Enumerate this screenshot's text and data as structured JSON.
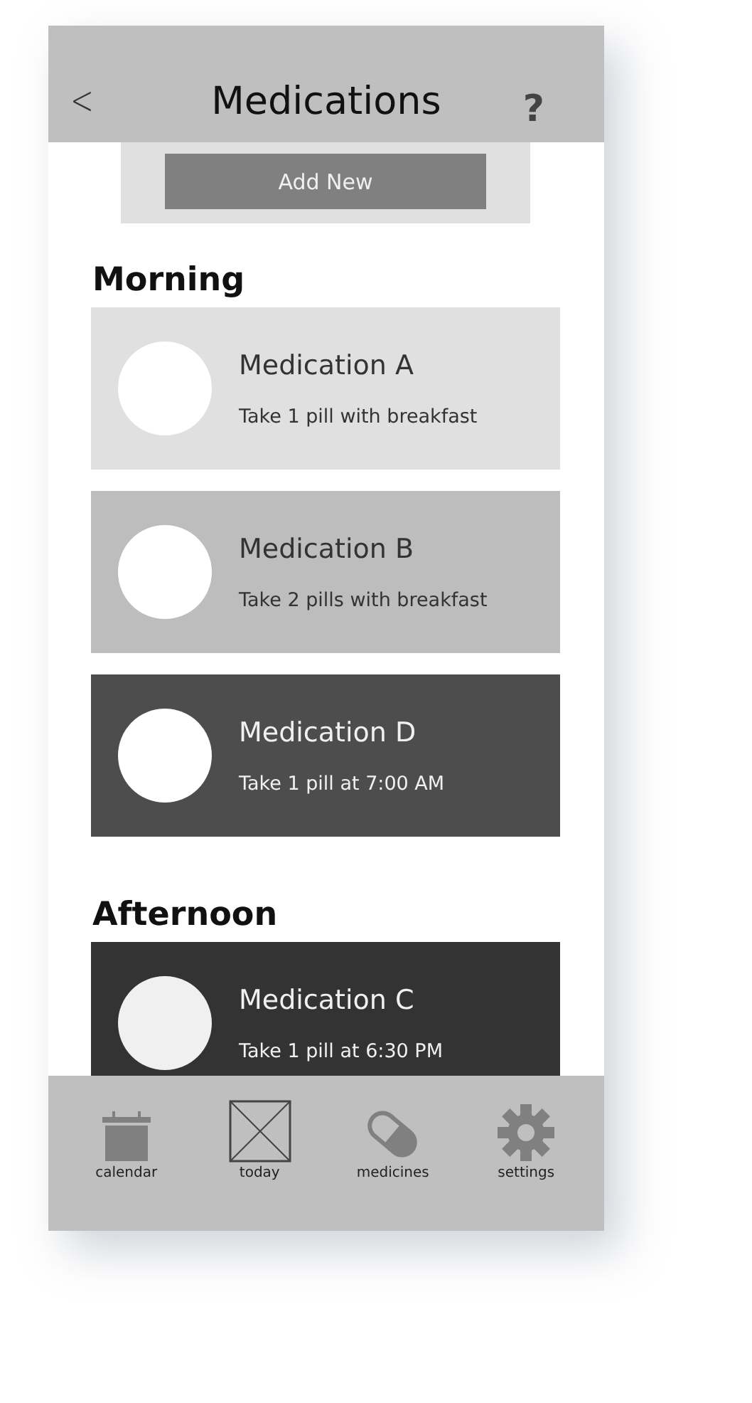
{
  "header": {
    "title": "Medications",
    "back": "<",
    "help": "?"
  },
  "add_button": "Add New",
  "sections": [
    {
      "title": "Morning",
      "medications": [
        {
          "name": "Medication A",
          "instructions": "Take 1 pill with breakfast",
          "color": "#e0e0e0"
        },
        {
          "name": "Medication B",
          "instructions": "Take 2 pills with breakfast",
          "color": "#bdbdbd"
        },
        {
          "name": "Medication D",
          "instructions": "Take 1 pill at 7:00 AM",
          "color": "#4d4d4d"
        }
      ]
    },
    {
      "title": "Afternoon",
      "medications": [
        {
          "name": "Medication C",
          "instructions": "Take 1 pill at 6:30 PM",
          "color": "#333333"
        }
      ]
    }
  ],
  "nav": [
    {
      "kind": "calendar",
      "label": "calendar"
    },
    {
      "kind": "today",
      "label": "today"
    },
    {
      "kind": "medicines",
      "label": "medicines"
    },
    {
      "kind": "settings",
      "label": "settings"
    }
  ]
}
